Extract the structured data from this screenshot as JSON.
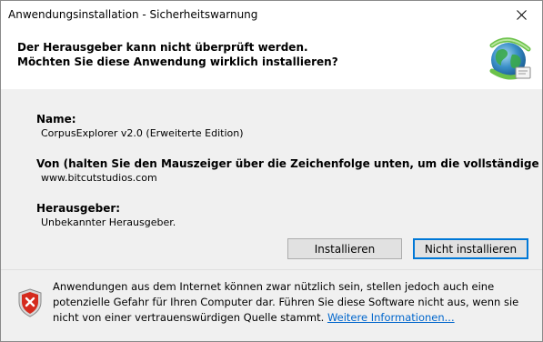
{
  "window": {
    "title": "Anwendungsinstallation - Sicherheitswarnung"
  },
  "header": {
    "line1": "Der Herausgeber kann nicht überprüft werden.",
    "line2": "Möchten Sie diese Anwendung wirklich installieren?",
    "icon": "globe-install-icon"
  },
  "details": {
    "name_label": "Name:",
    "name_value": "CorpusExplorer v2.0 (Erweiterte Edition)",
    "from_label": "Von (halten Sie den Mauszeiger über die Zeichenfolge unten, um die vollständige Domäne anzuzei",
    "from_value": "www.bitcutstudios.com",
    "publisher_label": "Herausgeber:",
    "publisher_value": "Unbekannter Herausgeber."
  },
  "buttons": {
    "install": "Installieren",
    "dont_install": "Nicht installieren"
  },
  "footer": {
    "warning_text": "Anwendungen aus dem Internet können zwar nützlich sein, stellen jedoch auch eine potenzielle Gefahr für Ihren Computer dar. Führen Sie diese Software nicht aus, wenn sie nicht von einer vertrauenswürdigen Quelle stammt.",
    "more_info_link": "Weitere Informationen...",
    "icon": "security-shield-icon"
  },
  "colors": {
    "accent": "#0078d7",
    "link": "#0066cc",
    "panel_bg": "#f0f0f0"
  }
}
